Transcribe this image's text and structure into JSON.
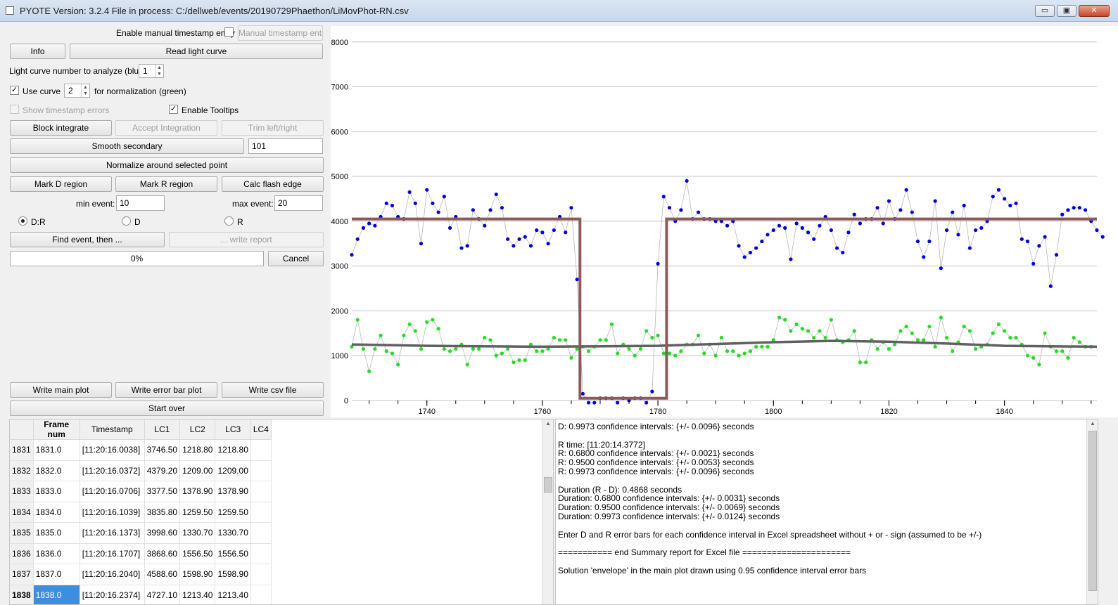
{
  "window": {
    "title": "PYOTE Version: 3.2.4  File in process: C:/dellweb/events/20190729Phaethon/LiMovPhot-RN.csv",
    "minimize_glyph": "▭",
    "maximize_glyph": "▣",
    "close_glyph": "✕"
  },
  "controls": {
    "manual_ts_label": "Enable manual timestamp entry",
    "manual_ts_button": "Manual timestamp entry",
    "info_button": "Info",
    "read_lc_button": "Read light curve",
    "lc_number_label": "Light curve number to analyze (blue):",
    "lc_number_value": "1",
    "use_curve_label": "Use curve",
    "use_curve_value": "2",
    "normalization_label": "for normalization (green)",
    "show_ts_errors_label": "Show timestamp errors",
    "enable_tooltips_label": "Enable Tooltips",
    "block_integrate_button": "Block integrate",
    "accept_integration_button": "Accept Integration",
    "trim_button": "Trim left/right",
    "smooth_secondary_button": "Smooth secondary",
    "smooth_value": "101",
    "normalize_button": "Normalize around selected point",
    "mark_d_button": "Mark D region",
    "mark_r_button": "Mark R region",
    "calc_flash_button": "Calc flash edge",
    "min_event_label": "min event:",
    "min_event_value": "10",
    "max_event_label": "max event:",
    "max_event_value": "20",
    "radio_dr": "D:R",
    "radio_d": "D",
    "radio_r": "R",
    "find_event_button": "Find event, then ...",
    "write_report_button": "... write report",
    "progress_text": "0%",
    "cancel_button": "Cancel",
    "write_main_plot_button": "Write main plot",
    "write_error_bar_button": "Write error bar plot",
    "write_csv_button": "Write csv file",
    "start_over_button": "Start over"
  },
  "table": {
    "headers": [
      "Frame num",
      "Timestamp",
      "LC1",
      "LC2",
      "LC3",
      "LC4"
    ],
    "rows": [
      {
        "rh": "1831",
        "frame": "1831.0",
        "ts": "[11:20:16.0038]",
        "lc1": "3746.50",
        "lc2": "1218.80",
        "lc3": "1218.80",
        "lc4": ""
      },
      {
        "rh": "1832",
        "frame": "1832.0",
        "ts": "[11:20:16.0372]",
        "lc1": "4379.20",
        "lc2": "1209.00",
        "lc3": "1209.00",
        "lc4": ""
      },
      {
        "rh": "1833",
        "frame": "1833.0",
        "ts": "[11:20:16.0706]",
        "lc1": "3377.50",
        "lc2": "1378.90",
        "lc3": "1378.90",
        "lc4": ""
      },
      {
        "rh": "1834",
        "frame": "1834.0",
        "ts": "[11:20:16.1039]",
        "lc1": "3835.80",
        "lc2": "1259.50",
        "lc3": "1259.50",
        "lc4": ""
      },
      {
        "rh": "1835",
        "frame": "1835.0",
        "ts": "[11:20:16.1373]",
        "lc1": "3998.60",
        "lc2": "1330.70",
        "lc3": "1330.70",
        "lc4": ""
      },
      {
        "rh": "1836",
        "frame": "1836.0",
        "ts": "[11:20:16.1707]",
        "lc1": "3868.60",
        "lc2": "1556.50",
        "lc3": "1556.50",
        "lc4": ""
      },
      {
        "rh": "1837",
        "frame": "1837.0",
        "ts": "[11:20:16.2040]",
        "lc1": "4588.60",
        "lc2": "1598.90",
        "lc3": "1598.90",
        "lc4": ""
      },
      {
        "rh": "1838",
        "frame": "1838.0",
        "ts": "[11:20:16.2374]",
        "lc1": "4727.10",
        "lc2": "1213.40",
        "lc3": "1213.40",
        "lc4": ""
      }
    ]
  },
  "report": {
    "lines": [
      "D: 0.9973 confidence intervals: {+/- 0.0096} seconds",
      "",
      "R time: [11:20:14.3772]",
      "R: 0.6800 confidence intervals: {+/- 0.0021} seconds",
      "R: 0.9500 confidence intervals: {+/- 0.0053} seconds",
      "R: 0.9973 confidence intervals: {+/- 0.0096} seconds",
      "",
      "Duration (R - D): 0.4868 seconds",
      "Duration: 0.6800 confidence intervals: {+/- 0.0031} seconds",
      "Duration: 0.9500 confidence intervals: {+/- 0.0069} seconds",
      "Duration: 0.9973 confidence intervals: {+/- 0.0124} seconds",
      "",
      "Enter D and R error bars for each confidence interval in Excel spreadsheet without + or - sign (assumed to be +/-)",
      "",
      "=========== end Summary report for Excel file ======================",
      "",
      "Solution 'envelope' in the main plot drawn using 0.95 confidence interval error bars"
    ]
  },
  "chart_data": {
    "type": "scatter",
    "title": "",
    "xlabel": "",
    "ylabel": "",
    "xlim": [
      1727,
      1856
    ],
    "ylim": [
      -300,
      8200
    ],
    "x_ticks": [
      1740,
      1760,
      1780,
      1800,
      1820,
      1840
    ],
    "y_ticks": [
      0,
      1000,
      2000,
      3000,
      4000,
      5000,
      6000,
      7000,
      8000
    ],
    "grid": "horizontal",
    "x_start": 1727,
    "x_step": 1,
    "colors": {
      "primary": "#0000dd",
      "secondary": "#22dd22",
      "smooth": "#606060",
      "solution": "#8b5a5a",
      "connector": "#b8b8b8"
    },
    "series": [
      {
        "role": "lc1-blue",
        "values": [
          3250,
          3600,
          3850,
          3950,
          3900,
          4100,
          4400,
          4350,
          4100,
          4050,
          4650,
          4400,
          3500,
          4700,
          4400,
          4200,
          4550,
          3850,
          4100,
          3400,
          3450,
          4250,
          4050,
          3900,
          4250,
          4600,
          4300,
          3600,
          3450,
          3600,
          3650,
          3450,
          3800,
          3750,
          3500,
          3800,
          4100,
          3750,
          4300,
          2700,
          150,
          -50,
          -50,
          50,
          50,
          50,
          -50,
          50,
          0,
          50,
          50,
          -50,
          200,
          3050,
          4550,
          4300,
          4000,
          4250,
          4900,
          4050,
          4200,
          4050,
          4050,
          4000,
          4000,
          3900,
          4000,
          3450,
          3200,
          3300,
          3400,
          3550,
          3700,
          3800,
          3900,
          3850,
          3150,
          3950,
          3850,
          3750,
          3600,
          3900,
          4100,
          3800,
          3400,
          3300,
          3750,
          4150,
          3950,
          4050,
          4050,
          4300,
          3950,
          4450,
          4050,
          4250,
          4700,
          4200,
          3550,
          3200,
          3550,
          4450,
          2950,
          3800,
          4200,
          3700,
          4350,
          3400,
          3800,
          3850,
          4000,
          4550,
          4700,
          4500,
          4350,
          4400,
          3600,
          3550,
          3050,
          3450,
          3650,
          2550,
          3250,
          4150,
          4250,
          4300,
          4300,
          4250,
          4000,
          3800,
          3650
        ]
      },
      {
        "role": "lc2-green",
        "values": [
          1200,
          1800,
          1150,
          650,
          1150,
          1450,
          1100,
          1050,
          800,
          1450,
          1700,
          1550,
          1150,
          1750,
          1800,
          1600,
          1150,
          1100,
          1150,
          1250,
          800,
          1150,
          1150,
          1400,
          1350,
          1000,
          1050,
          1150,
          850,
          900,
          900,
          1250,
          1100,
          1100,
          1150,
          1400,
          1350,
          1350,
          950,
          1150,
          1200,
          1100,
          1200,
          1350,
          1350,
          1700,
          1050,
          1250,
          1150,
          1000,
          1150,
          1550,
          1400,
          1450,
          1050,
          1050,
          1000,
          1100,
          1250,
          1250,
          1450,
          1050,
          1250,
          1000,
          1400,
          1100,
          1100,
          1000,
          1050,
          1100,
          1200,
          1200,
          1200,
          1350,
          1850,
          1800,
          1550,
          1700,
          1600,
          1550,
          1400,
          1550,
          1400,
          1800,
          1350,
          1300,
          1350,
          1550,
          850,
          850,
          1350,
          1150,
          1300,
          1150,
          1250,
          1550,
          1650,
          1500,
          1350,
          1350,
          1650,
          1200,
          1850,
          1400,
          1100,
          1300,
          1650,
          1550,
          1150,
          1200,
          1250,
          1500,
          1700,
          1550,
          1400,
          1400,
          1250,
          1000,
          950,
          800,
          1500,
          1200,
          1100,
          1100,
          950,
          1400,
          1300,
          1200,
          1200
        ]
      }
    ],
    "smooth_curve": {
      "x": [
        1727,
        1740,
        1760,
        1780,
        1800,
        1810,
        1820,
        1830,
        1840,
        1856
      ],
      "y": [
        1250,
        1220,
        1200,
        1220,
        1300,
        1330,
        1310,
        1270,
        1220,
        1200
      ]
    },
    "solution_envelope": {
      "x": [
        1727,
        1766.5,
        1766.5,
        1781.5,
        1781.5,
        1856
      ],
      "y": [
        4050,
        4050,
        50,
        50,
        4050,
        4050
      ]
    }
  }
}
